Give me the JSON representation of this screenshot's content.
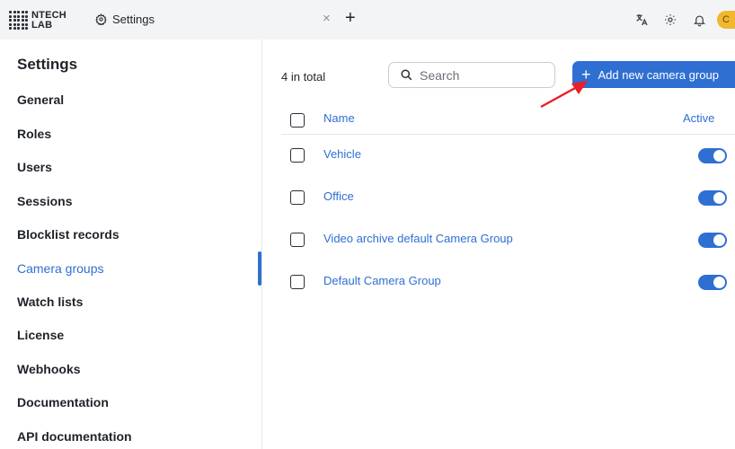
{
  "brand": {
    "line1": "NTECH",
    "line2": "LAB"
  },
  "tab": {
    "label": "Settings",
    "close": "×",
    "add": "+"
  },
  "topbar": {
    "icons": [
      "translate-icon",
      "theme-sun-icon",
      "bell-icon"
    ],
    "avatar_initial": "C"
  },
  "sidebar": {
    "title": "Settings",
    "items": [
      {
        "label": "General"
      },
      {
        "label": "Roles"
      },
      {
        "label": "Users"
      },
      {
        "label": "Sessions"
      },
      {
        "label": "Blocklist records"
      },
      {
        "label": "Camera groups",
        "active": true
      },
      {
        "label": "Watch lists"
      },
      {
        "label": "License"
      },
      {
        "label": "Webhooks"
      },
      {
        "label": "Documentation"
      },
      {
        "label": "API documentation"
      }
    ]
  },
  "main": {
    "count": "4 in total",
    "search_placeholder": "Search",
    "add_button": "Add new camera group",
    "columns": {
      "name": "Name",
      "active": "Active"
    },
    "rows": [
      {
        "name": "Vehicle",
        "active": true
      },
      {
        "name": "Office",
        "active": true
      },
      {
        "name": "Video archive default Camera Group",
        "active": true
      },
      {
        "name": "Default Camera Group",
        "active": true
      }
    ]
  },
  "colors": {
    "accent": "#2f6fd1",
    "annotation_arrow": "#e8202a",
    "avatar": "#f0b72f"
  }
}
